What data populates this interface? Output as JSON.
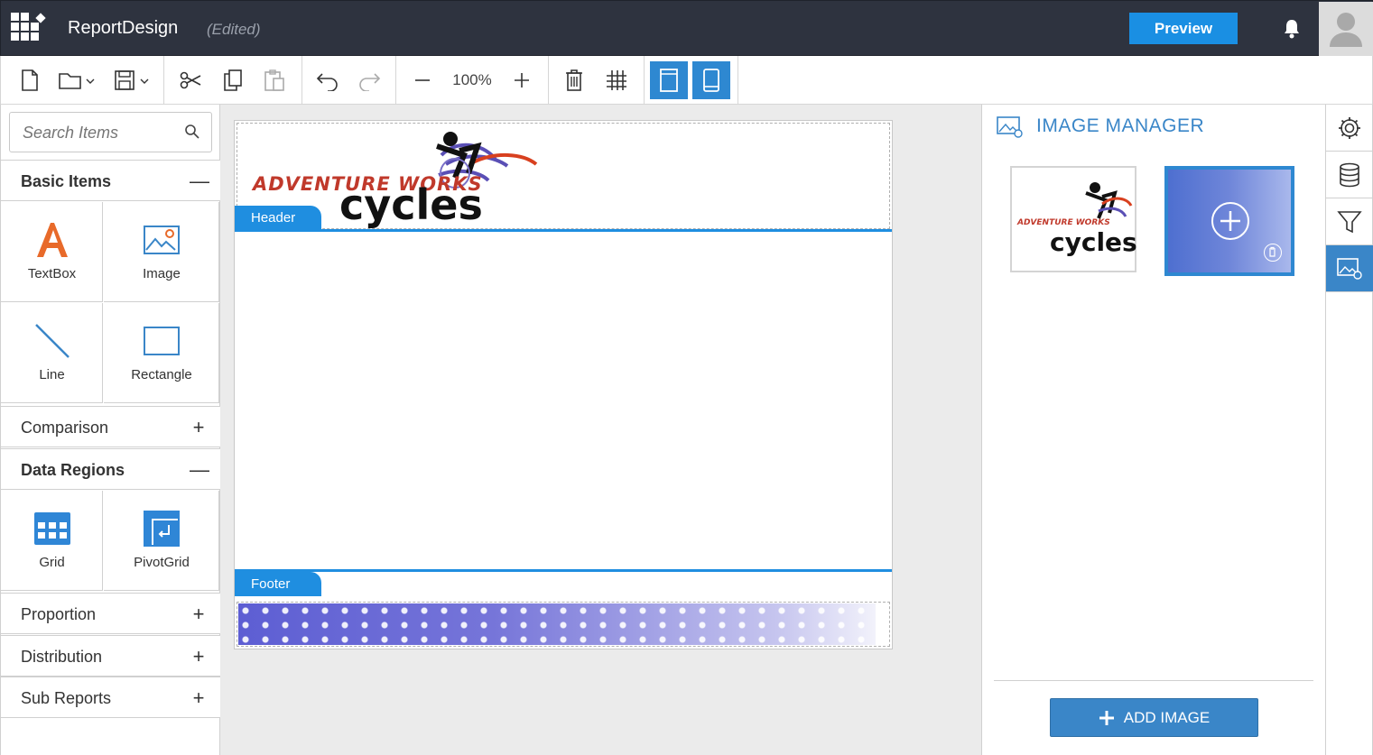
{
  "header": {
    "app_title": "ReportDesign",
    "status": "(Edited)",
    "preview_label": "Preview"
  },
  "toolbar": {
    "zoom": "100%",
    "icons": [
      "new-file-icon",
      "open-folder-icon",
      "save-icon",
      "cut-icon",
      "copy-icon",
      "paste-icon",
      "undo-icon",
      "redo-icon",
      "zoom-out-icon",
      "zoom-in-icon",
      "delete-icon",
      "grid-icon",
      "portrait-layout-icon",
      "mobile-layout-icon"
    ]
  },
  "left_panel": {
    "search_placeholder": "Search Items",
    "sections": [
      {
        "label": "Basic Items",
        "expanded": true,
        "items": [
          "TextBox",
          "Image",
          "Line",
          "Rectangle"
        ]
      },
      {
        "label": "Comparison",
        "expanded": false
      },
      {
        "label": "Data Regions",
        "expanded": true,
        "items": [
          "Grid",
          "PivotGrid"
        ]
      },
      {
        "label": "Proportion",
        "expanded": false
      },
      {
        "label": "Distribution",
        "expanded": false
      },
      {
        "label": "Sub Reports",
        "expanded": false
      }
    ],
    "expanded_symbol": "—",
    "collapsed_symbol": "+"
  },
  "canvas": {
    "header_tab": "Header",
    "footer_tab": "Footer",
    "logo_text_top": "ADVENTURE WORKS",
    "logo_text_bottom": "cycles"
  },
  "image_manager": {
    "title": "IMAGE MANAGER",
    "add_label": "ADD IMAGE",
    "thumb_logo_top": "ADVENTURE WORKS",
    "thumb_logo_bottom": "cycles"
  },
  "colors": {
    "topbar": "#2e333f",
    "accent": "#1a8fe3",
    "panel_accent": "#3a86c8",
    "logo_red": "#c0392b"
  }
}
